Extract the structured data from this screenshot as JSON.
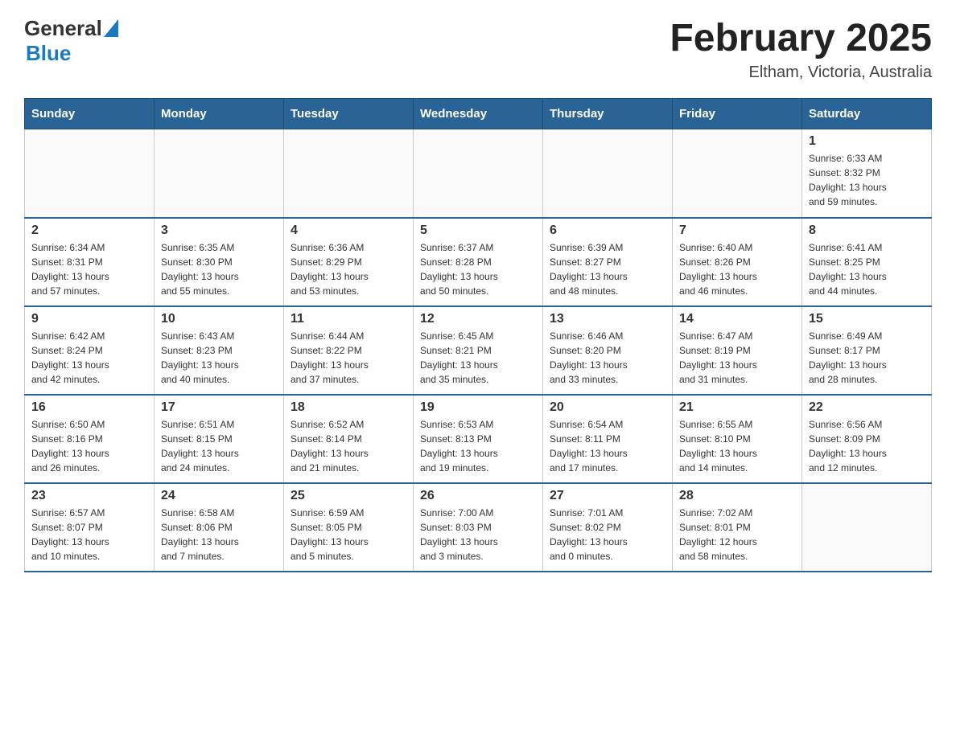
{
  "header": {
    "logo_general": "General",
    "logo_blue": "Blue",
    "month_title": "February 2025",
    "location": "Eltham, Victoria, Australia"
  },
  "weekdays": [
    "Sunday",
    "Monday",
    "Tuesday",
    "Wednesday",
    "Thursday",
    "Friday",
    "Saturday"
  ],
  "weeks": [
    [
      {
        "day": "",
        "info": ""
      },
      {
        "day": "",
        "info": ""
      },
      {
        "day": "",
        "info": ""
      },
      {
        "day": "",
        "info": ""
      },
      {
        "day": "",
        "info": ""
      },
      {
        "day": "",
        "info": ""
      },
      {
        "day": "1",
        "info": "Sunrise: 6:33 AM\nSunset: 8:32 PM\nDaylight: 13 hours\nand 59 minutes."
      }
    ],
    [
      {
        "day": "2",
        "info": "Sunrise: 6:34 AM\nSunset: 8:31 PM\nDaylight: 13 hours\nand 57 minutes."
      },
      {
        "day": "3",
        "info": "Sunrise: 6:35 AM\nSunset: 8:30 PM\nDaylight: 13 hours\nand 55 minutes."
      },
      {
        "day": "4",
        "info": "Sunrise: 6:36 AM\nSunset: 8:29 PM\nDaylight: 13 hours\nand 53 minutes."
      },
      {
        "day": "5",
        "info": "Sunrise: 6:37 AM\nSunset: 8:28 PM\nDaylight: 13 hours\nand 50 minutes."
      },
      {
        "day": "6",
        "info": "Sunrise: 6:39 AM\nSunset: 8:27 PM\nDaylight: 13 hours\nand 48 minutes."
      },
      {
        "day": "7",
        "info": "Sunrise: 6:40 AM\nSunset: 8:26 PM\nDaylight: 13 hours\nand 46 minutes."
      },
      {
        "day": "8",
        "info": "Sunrise: 6:41 AM\nSunset: 8:25 PM\nDaylight: 13 hours\nand 44 minutes."
      }
    ],
    [
      {
        "day": "9",
        "info": "Sunrise: 6:42 AM\nSunset: 8:24 PM\nDaylight: 13 hours\nand 42 minutes."
      },
      {
        "day": "10",
        "info": "Sunrise: 6:43 AM\nSunset: 8:23 PM\nDaylight: 13 hours\nand 40 minutes."
      },
      {
        "day": "11",
        "info": "Sunrise: 6:44 AM\nSunset: 8:22 PM\nDaylight: 13 hours\nand 37 minutes."
      },
      {
        "day": "12",
        "info": "Sunrise: 6:45 AM\nSunset: 8:21 PM\nDaylight: 13 hours\nand 35 minutes."
      },
      {
        "day": "13",
        "info": "Sunrise: 6:46 AM\nSunset: 8:20 PM\nDaylight: 13 hours\nand 33 minutes."
      },
      {
        "day": "14",
        "info": "Sunrise: 6:47 AM\nSunset: 8:19 PM\nDaylight: 13 hours\nand 31 minutes."
      },
      {
        "day": "15",
        "info": "Sunrise: 6:49 AM\nSunset: 8:17 PM\nDaylight: 13 hours\nand 28 minutes."
      }
    ],
    [
      {
        "day": "16",
        "info": "Sunrise: 6:50 AM\nSunset: 8:16 PM\nDaylight: 13 hours\nand 26 minutes."
      },
      {
        "day": "17",
        "info": "Sunrise: 6:51 AM\nSunset: 8:15 PM\nDaylight: 13 hours\nand 24 minutes."
      },
      {
        "day": "18",
        "info": "Sunrise: 6:52 AM\nSunset: 8:14 PM\nDaylight: 13 hours\nand 21 minutes."
      },
      {
        "day": "19",
        "info": "Sunrise: 6:53 AM\nSunset: 8:13 PM\nDaylight: 13 hours\nand 19 minutes."
      },
      {
        "day": "20",
        "info": "Sunrise: 6:54 AM\nSunset: 8:11 PM\nDaylight: 13 hours\nand 17 minutes."
      },
      {
        "day": "21",
        "info": "Sunrise: 6:55 AM\nSunset: 8:10 PM\nDaylight: 13 hours\nand 14 minutes."
      },
      {
        "day": "22",
        "info": "Sunrise: 6:56 AM\nSunset: 8:09 PM\nDaylight: 13 hours\nand 12 minutes."
      }
    ],
    [
      {
        "day": "23",
        "info": "Sunrise: 6:57 AM\nSunset: 8:07 PM\nDaylight: 13 hours\nand 10 minutes."
      },
      {
        "day": "24",
        "info": "Sunrise: 6:58 AM\nSunset: 8:06 PM\nDaylight: 13 hours\nand 7 minutes."
      },
      {
        "day": "25",
        "info": "Sunrise: 6:59 AM\nSunset: 8:05 PM\nDaylight: 13 hours\nand 5 minutes."
      },
      {
        "day": "26",
        "info": "Sunrise: 7:00 AM\nSunset: 8:03 PM\nDaylight: 13 hours\nand 3 minutes."
      },
      {
        "day": "27",
        "info": "Sunrise: 7:01 AM\nSunset: 8:02 PM\nDaylight: 13 hours\nand 0 minutes."
      },
      {
        "day": "28",
        "info": "Sunrise: 7:02 AM\nSunset: 8:01 PM\nDaylight: 12 hours\nand 58 minutes."
      },
      {
        "day": "",
        "info": ""
      }
    ]
  ]
}
